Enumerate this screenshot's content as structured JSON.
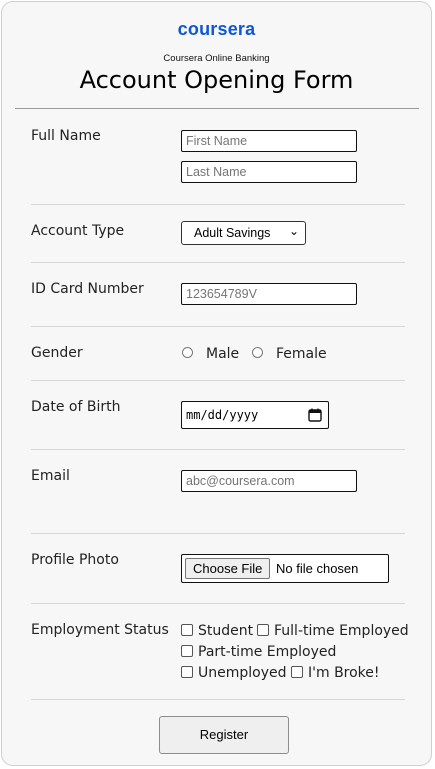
{
  "header": {
    "logo_text": "coursera",
    "subtitle": "Coursera Online Banking",
    "title": "Account Opening Form"
  },
  "fields": {
    "full_name": {
      "label": "Full Name",
      "first_placeholder": "First Name",
      "last_placeholder": "Last Name"
    },
    "account_type": {
      "label": "Account Type",
      "selected": "Adult Savings"
    },
    "id_card": {
      "label": "ID Card Number",
      "placeholder": "123654789V"
    },
    "gender": {
      "label": "Gender",
      "options": [
        "Male",
        "Female"
      ]
    },
    "dob": {
      "label": "Date of Birth",
      "placeholder": "mm/dd/yyyy"
    },
    "email": {
      "label": "Email",
      "placeholder": "abc@coursera.com"
    },
    "photo": {
      "label": "Profile Photo",
      "button": "Choose File",
      "status": "No file chosen"
    },
    "employment": {
      "label": "Employment Status",
      "options": [
        "Student",
        "Full-time Employed",
        "Part-time Employed",
        "Unemployed",
        "I'm Broke!"
      ]
    }
  },
  "actions": {
    "register": "Register"
  },
  "colors": {
    "brand": "#0f56d9"
  }
}
